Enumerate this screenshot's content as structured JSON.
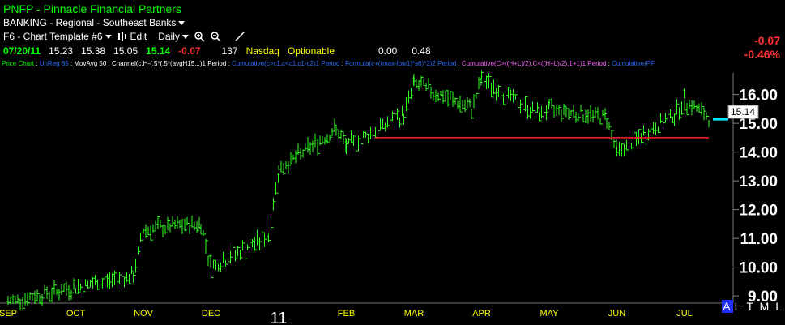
{
  "header": {
    "title": "PNFP - Pinnacle Financial Partners",
    "industry": "BANKING - Regional - Southeast Banks",
    "template_label": "F6 - Chart Template #6",
    "edit_label": "Edit",
    "period_label": "Daily"
  },
  "quote": {
    "date": "07/20/11",
    "open": "15.23",
    "high": "15.38",
    "low": "15.05",
    "last": "15.14",
    "change": "-0.07",
    "volume": "137",
    "exchange": "Nasdaq",
    "optionable": "Optionable",
    "field_a": "0.00",
    "field_b": "0.48",
    "change_right": "-0.07",
    "change_pct": "-0.46%"
  },
  "studies": [
    {
      "text": "Price Chart",
      "color": "#00ff00"
    },
    {
      "text": "UnReg 65",
      "color": "#2a6cff"
    },
    {
      "text": "MovAvg 50",
      "color": "#ffffff"
    },
    {
      "text": "Channel(c,H-(.5*(.5*(avgH15...)1 Period",
      "color": "#ffffff"
    },
    {
      "text": "Cumulative(c>c1,c<c1,c1-c2)1 Period",
      "color": "#2a6cff"
    },
    {
      "text": "Formula(c+((max-low1)*s6)*2)2 Period",
      "color": "#2a6cff"
    },
    {
      "text": "Cumulative(C>((H+L)/2),C<((H+L)/2),1+1)1 Period",
      "color": "#ff60ff"
    },
    {
      "text": "Cumulative(PF",
      "color": "#2a6cff"
    }
  ],
  "flag": {
    "a": "A",
    "rest": "L T M L"
  },
  "chart_data": {
    "type": "line",
    "x_labels": [
      "SEP",
      "OCT",
      "NOV",
      "DEC",
      "11",
      "FEB",
      "MAR",
      "APR",
      "MAY",
      "JUN",
      "JUL"
    ],
    "y_ticks": [
      "16.00",
      "15.00",
      "14.00",
      "13.00",
      "12.00",
      "11.00",
      "10.00",
      "9.00"
    ],
    "ylim": [
      8.75,
      16.75
    ],
    "last_price_label": "15.14",
    "series": [
      {
        "x": [
          "SEP",
          "OCT",
          "OCT",
          "NOV",
          "NOV",
          "DEC",
          "DEC",
          "11",
          "11",
          "FEB",
          "FEB",
          "MAR",
          "MAR",
          "APR",
          "APR",
          "MAY",
          "MAY",
          "JUN",
          "JUN",
          "JUL",
          "JUL"
        ],
        "values": [
          8.8,
          9.3,
          9.7,
          11.3,
          11.5,
          10.0,
          11.1,
          13.4,
          14.8,
          14.2,
          15.3,
          16.4,
          15.5,
          16.5,
          15.3,
          15.5,
          15.2,
          14.0,
          15.3,
          15.8,
          15.14
        ]
      }
    ],
    "support_line": {
      "value": 14.5,
      "from": "FEB",
      "to": "JUL"
    },
    "grid": false
  }
}
